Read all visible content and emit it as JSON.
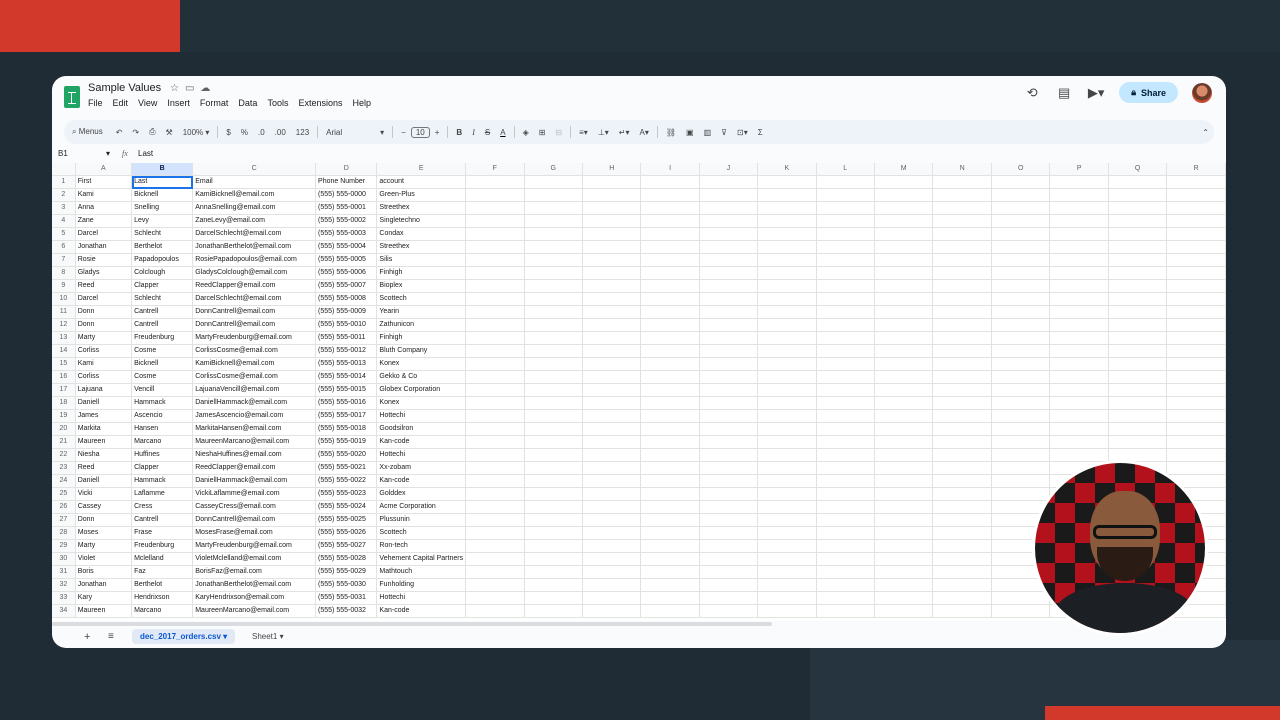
{
  "doc": {
    "title": "Sample Values"
  },
  "menu": [
    "File",
    "Edit",
    "View",
    "Insert",
    "Format",
    "Data",
    "Tools",
    "Extensions",
    "Help"
  ],
  "share_label": "Share",
  "toolbar": {
    "menus": "Menus",
    "zoom": "100%",
    "currency": "$",
    "percent": "%",
    "dec_less": ".0",
    "dec_more": ".00",
    "number_format": "123",
    "font": "Arial",
    "font_size": "10"
  },
  "formula_bar": {
    "cell_ref": "B1",
    "value": "Last"
  },
  "columns": [
    "A",
    "B",
    "C",
    "D",
    "E",
    "F",
    "G",
    "H",
    "I",
    "J",
    "K",
    "L",
    "M",
    "N",
    "O",
    "P",
    "Q",
    "R"
  ],
  "rows": [
    [
      "1",
      "First",
      "Last",
      "Email",
      "Phone Number",
      "account"
    ],
    [
      "2",
      "Kami",
      "Bicknell",
      "KamiBicknell@email.com",
      "(555) 555-0000",
      "Green-Plus"
    ],
    [
      "3",
      "Anna",
      "Snelling",
      "AnnaSnelling@email.com",
      "(555) 555-0001",
      "Streethex"
    ],
    [
      "4",
      "Zane",
      "Levy",
      "ZaneLevy@email.com",
      "(555) 555-0002",
      "Singletechno"
    ],
    [
      "5",
      "Darcel",
      "Schlecht",
      "DarcelSchlecht@email.com",
      "(555) 555-0003",
      "Condax"
    ],
    [
      "6",
      "Jonathan",
      "Berthelot",
      "JonathanBerthelot@email.com",
      "(555) 555-0004",
      "Streethex"
    ],
    [
      "7",
      "Rosie",
      "Papadopoulos",
      "RosiePapadopoulos@email.com",
      "(555) 555-0005",
      "Silis"
    ],
    [
      "8",
      "Gladys",
      "Colclough",
      "GladysColclough@email.com",
      "(555) 555-0006",
      "Finhigh"
    ],
    [
      "9",
      "Reed",
      "Clapper",
      "ReedClapper@email.com",
      "(555) 555-0007",
      "Bioplex"
    ],
    [
      "10",
      "Darcel",
      "Schlecht",
      "DarcelSchlecht@email.com",
      "(555) 555-0008",
      "Scottech"
    ],
    [
      "11",
      "Donn",
      "Cantrell",
      "DonnCantrell@email.com",
      "(555) 555-0009",
      "Yearin"
    ],
    [
      "12",
      "Donn",
      "Cantrell",
      "DonnCantrell@email.com",
      "(555) 555-0010",
      "Zathunicon"
    ],
    [
      "13",
      "Marty",
      "Freudenburg",
      "MartyFreudenburg@email.com",
      "(555) 555-0011",
      "Finhigh"
    ],
    [
      "14",
      "Corliss",
      "Cosme",
      "CorlissCosme@email.com",
      "(555) 555-0012",
      "Bluth Company"
    ],
    [
      "15",
      "Kami",
      "Bicknell",
      "KamiBicknell@email.com",
      "(555) 555-0013",
      "Konex"
    ],
    [
      "16",
      "Corliss",
      "Cosme",
      "CorlissCosme@email.com",
      "(555) 555-0014",
      "Gekko & Co"
    ],
    [
      "17",
      "Lajuana",
      "Vencill",
      "LajuanaVencill@email.com",
      "(555) 555-0015",
      "Globex Corporation"
    ],
    [
      "18",
      "Daniell",
      "Hammack",
      "DaniellHammack@email.com",
      "(555) 555-0016",
      "Konex"
    ],
    [
      "19",
      "James",
      "Ascencio",
      "JamesAscencio@email.com",
      "(555) 555-0017",
      "Hottechi"
    ],
    [
      "20",
      "Markita",
      "Hansen",
      "MarkitaHansen@email.com",
      "(555) 555-0018",
      "Goodsilron"
    ],
    [
      "21",
      "Maureen",
      "Marcano",
      "MaureenMarcano@email.com",
      "(555) 555-0019",
      "Kan-code"
    ],
    [
      "22",
      "Niesha",
      "Huffines",
      "NieshaHuffines@email.com",
      "(555) 555-0020",
      "Hottechi"
    ],
    [
      "23",
      "Reed",
      "Clapper",
      "ReedClapper@email.com",
      "(555) 555-0021",
      "Xx-zobam"
    ],
    [
      "24",
      "Daniell",
      "Hammack",
      "DaniellHammack@email.com",
      "(555) 555-0022",
      "Kan-code"
    ],
    [
      "25",
      "Vicki",
      "Laflamme",
      "VickiLaflamme@email.com",
      "(555) 555-0023",
      "Golddex"
    ],
    [
      "26",
      "Cassey",
      "Cress",
      "CasseyCress@email.com",
      "(555) 555-0024",
      "Acme Corporation"
    ],
    [
      "27",
      "Donn",
      "Cantrell",
      "DonnCantrell@email.com",
      "(555) 555-0025",
      "Plussunin"
    ],
    [
      "28",
      "Moses",
      "Frase",
      "MosesFrase@email.com",
      "(555) 555-0026",
      "Scottech"
    ],
    [
      "29",
      "Marty",
      "Freudenburg",
      "MartyFreudenburg@email.com",
      "(555) 555-0027",
      "Ron-tech"
    ],
    [
      "30",
      "Violet",
      "Mclelland",
      "VioletMclelland@email.com",
      "(555) 555-0028",
      "Vehement Capital Partners"
    ],
    [
      "31",
      "Boris",
      "Faz",
      "BorisFaz@email.com",
      "(555) 555-0029",
      "Mathtouch"
    ],
    [
      "32",
      "Jonathan",
      "Berthelot",
      "JonathanBerthelot@email.com",
      "(555) 555-0030",
      "Funholding"
    ],
    [
      "33",
      "Kary",
      "Hendrixson",
      "KaryHendrixson@email.com",
      "(555) 555-0031",
      "Hottechi"
    ],
    [
      "34",
      "Maureen",
      "Marcano",
      "MaureenMarcano@email.com",
      "(555) 555-0032",
      "Kan-code"
    ]
  ],
  "sheets": {
    "active": "dec_2017_orders.csv",
    "other": "Sheet1"
  }
}
